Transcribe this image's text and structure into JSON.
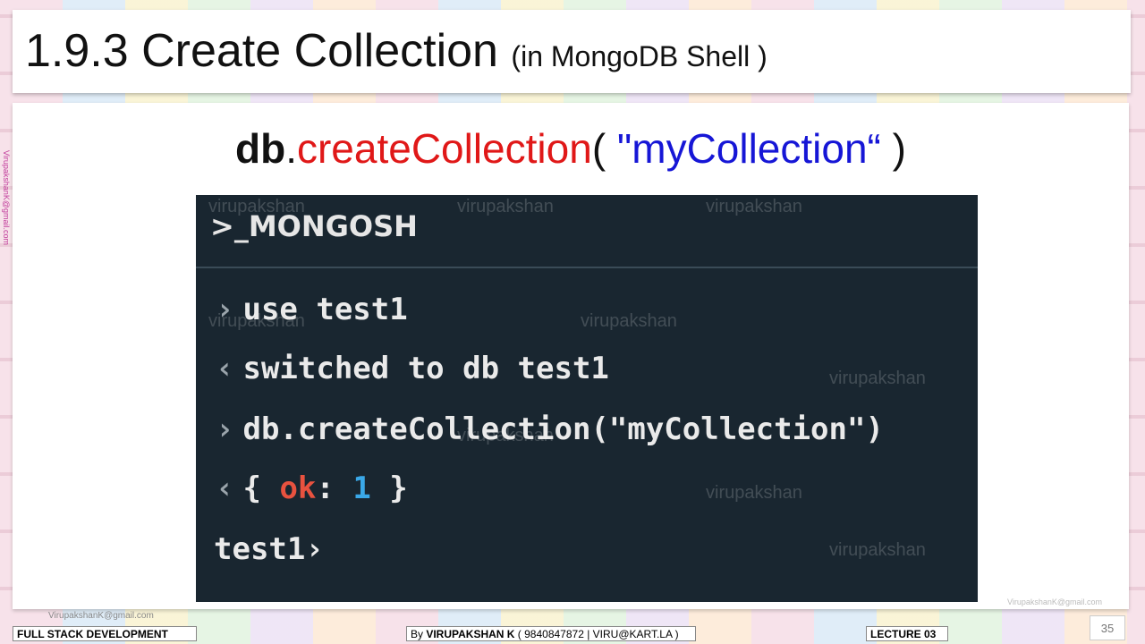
{
  "slide": {
    "title": "1.9.3 Create Collection",
    "title_sub": "(in MongoDB Shell  )",
    "code_title": {
      "db": "db",
      "dot": ".",
      "fn": "createCollection",
      "open": "( ",
      "arg": "\"myCollection“",
      "close": " )"
    }
  },
  "shell": {
    "logo": ">_MONGOSH",
    "lines": {
      "l1": {
        "prompt": "›",
        "text": "use test1"
      },
      "l2": {
        "prompt": "‹",
        "text": "switched to db test1"
      },
      "l3": {
        "prompt": "›",
        "text": "db.createCollection(\"myCollection\")"
      },
      "l4": {
        "prompt": "‹",
        "open": "{ ",
        "key": "ok",
        "colon": ": ",
        "val": "1",
        "close": " }"
      },
      "l5": {
        "text": "test1›"
      }
    }
  },
  "watermark": {
    "text": "virupakshan",
    "email": "VirupakshanK@gmail.com"
  },
  "footer": {
    "course": "FULL STACK DEVELOPMENT",
    "by_prefix": "By ",
    "author": "VIRUPAKSHAN K",
    "contact": " ( 9840847872 | VIRU@KART.LA )",
    "lecture": "LECTURE 03",
    "page_number": "35"
  }
}
